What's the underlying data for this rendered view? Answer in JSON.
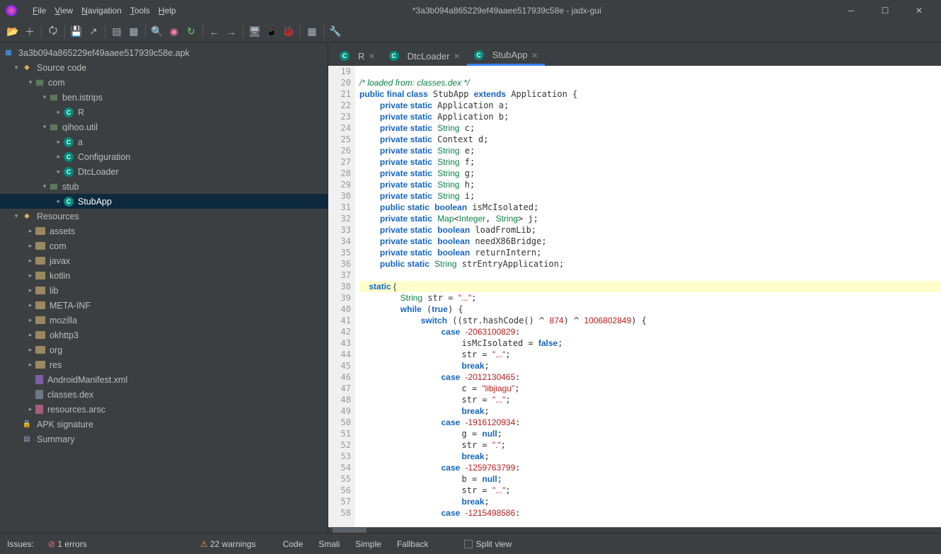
{
  "window": {
    "title": "*3a3b094a865229ef49aaee517939c58e - jadx-gui"
  },
  "menus": [
    "File",
    "View",
    "Navigation",
    "Tools",
    "Help"
  ],
  "tree": {
    "root": "3a3b094a865229ef49aaee517939c58e.apk",
    "src": "Source code",
    "com": "com",
    "ben": "ben.istrips",
    "r": "R",
    "qh": "qihoo.util",
    "a": "a",
    "cfg": "Configuration",
    "dtc": "DtcLoader",
    "stub": "stub",
    "stubapp": "StubApp",
    "res": "Resources",
    "folders": [
      "assets",
      "com",
      "javax",
      "kotlin",
      "lib",
      "META-INF",
      "mozilla",
      "okhttp3",
      "org",
      "res"
    ],
    "am": "AndroidManifest.xml",
    "cd": "classes.dex",
    "ra": "resources.arsc",
    "apk": "APK signature",
    "sum": "Summary"
  },
  "tabs": [
    {
      "label": "R"
    },
    {
      "label": "DtcLoader"
    },
    {
      "label": "StubApp"
    }
  ],
  "status": {
    "issues": "Issues:",
    "errors": "1 errors",
    "warnings": "22 warnings",
    "views": [
      "Code",
      "Smali",
      "Simple",
      "Fallback"
    ],
    "split": "Split view"
  },
  "code": {
    "start": 19
  }
}
